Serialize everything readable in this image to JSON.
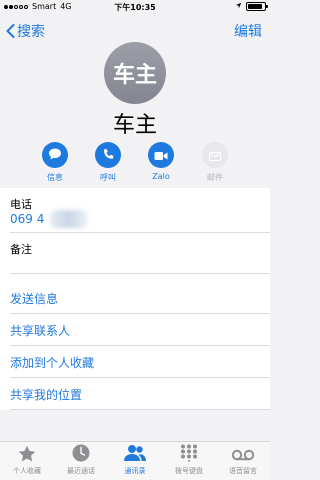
{
  "status_bar": {
    "carrier": "Smart",
    "network": "4G",
    "time": "下午10:35",
    "battery_level": 0.85
  },
  "nav": {
    "back_label": "搜索",
    "edit_label": "编辑"
  },
  "contact": {
    "avatar_text": "车主",
    "name": "车主"
  },
  "actions": [
    {
      "label": "信息",
      "icon": "message-icon"
    },
    {
      "label": "呼叫",
      "icon": "phone-icon"
    },
    {
      "label": "Zalo",
      "icon": "video-icon"
    },
    {
      "label": "邮件",
      "icon": "mail-icon"
    }
  ],
  "phone": {
    "label": "电话",
    "value": "069 4"
  },
  "notes": {
    "label": "备注"
  },
  "links": [
    {
      "label": "发送信息"
    },
    {
      "label": "共享联系人"
    },
    {
      "label": "添加到个人收藏"
    },
    {
      "label": "共享我的位置"
    }
  ],
  "tabs": [
    {
      "label": "个人收藏",
      "icon": "star-icon"
    },
    {
      "label": "最近通话",
      "icon": "clock-icon"
    },
    {
      "label": "通讯录",
      "icon": "contacts-icon"
    },
    {
      "label": "拨号键盘",
      "icon": "keypad-icon"
    },
    {
      "label": "语音留言",
      "icon": "voicemail-icon"
    }
  ],
  "colors": {
    "accent": "#1f7ae0",
    "avatar": "#8f919a",
    "background": "#f2f2f5"
  }
}
